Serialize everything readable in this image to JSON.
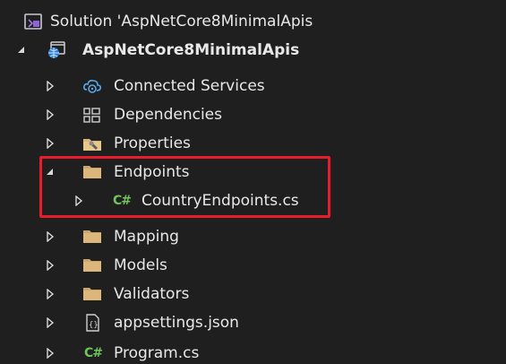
{
  "solution_explorer": {
    "solution": {
      "label": "Solution 'AspNetCore8MinimalApis",
      "icon": "solution-icon"
    },
    "project": {
      "label": "AspNetCore8MinimalApis",
      "icon": "web-project-icon",
      "expanded": true
    },
    "items": [
      {
        "label": "Connected Services",
        "icon": "connected-services-icon",
        "expanded": false
      },
      {
        "label": "Dependencies",
        "icon": "dependencies-icon",
        "expanded": false
      },
      {
        "label": "Properties",
        "icon": "properties-icon",
        "expanded": false
      },
      {
        "label": "Endpoints",
        "icon": "folder-icon",
        "expanded": true
      },
      {
        "label": "CountryEndpoints.cs",
        "icon": "csharp-file-icon",
        "expanded": false
      },
      {
        "label": "Mapping",
        "icon": "folder-icon",
        "expanded": false
      },
      {
        "label": "Models",
        "icon": "folder-icon",
        "expanded": false
      },
      {
        "label": "Validators",
        "icon": "folder-icon",
        "expanded": false
      },
      {
        "label": "appsettings.json",
        "icon": "json-file-icon",
        "expanded": false
      },
      {
        "label": "Program.cs",
        "icon": "csharp-file-icon",
        "expanded": false
      }
    ],
    "cs_glyph": "C#",
    "highlight_color": "#e81c2a",
    "folder_color": "#dcb67a",
    "csharp_color": "#6fc45b"
  }
}
